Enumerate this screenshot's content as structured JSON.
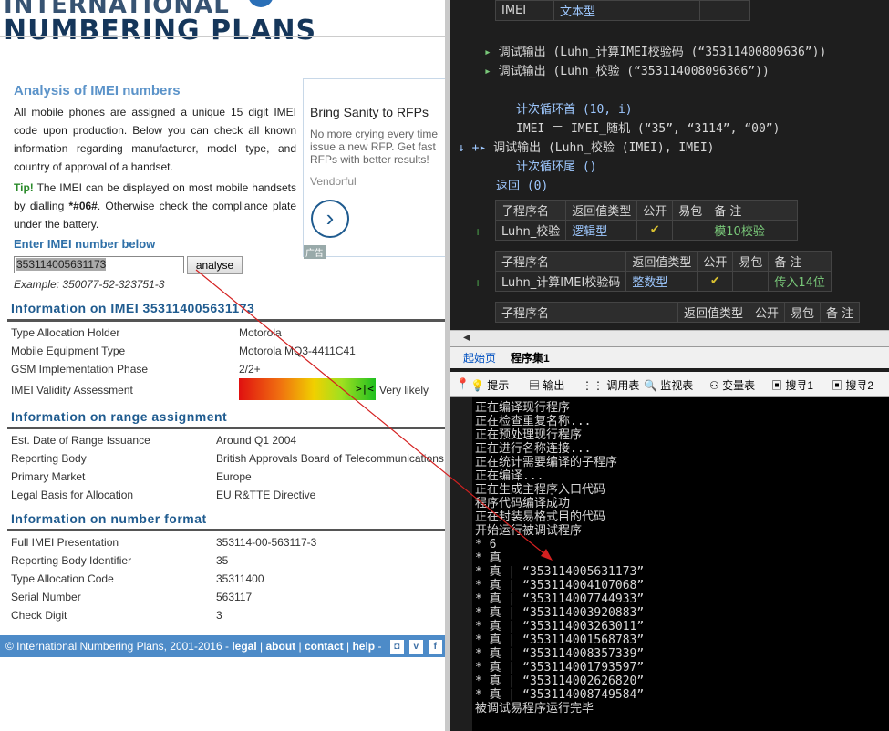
{
  "web": {
    "logo_line1": "INTERNATIONAL",
    "logo_line2": "NUMBERING PLANS",
    "heading": "Analysis of IMEI numbers",
    "intro": "All mobile phones are assigned a unique 15 digit IMEI code upon production. Below you can check all known information regarding manufacturer, model type, and country of approval of a handset.",
    "tip_label": "Tip!",
    "tip_text": " The IMEI can be displayed on most mobile handsets by dialling ",
    "tip_code": "*#06#",
    "tip_text2": ". Otherwise check the compliance plate under the battery.",
    "enter_heading": "Enter IMEI number below",
    "imei_value": "353114005631173",
    "analyse_label": "analyse",
    "example": "Example: 350077-52-323751-3",
    "sec1": "Information on IMEI 353114005631173",
    "sec1_rows": [
      {
        "k": "Type Allocation Holder",
        "v": "Motorola"
      },
      {
        "k": "Mobile Equipment Type",
        "v": "Motorola MQ3-4411C41"
      },
      {
        "k": "GSM Implementation Phase",
        "v": "2/2+"
      },
      {
        "k": "IMEI Validity Assessment",
        "v": "Very likely"
      }
    ],
    "validity_marker": ">|<",
    "validity_level": 0.92,
    "sec2": "Information on range assignment",
    "sec2_rows": [
      {
        "k": "Est. Date of Range Issuance",
        "v": "Around Q1 2004"
      },
      {
        "k": "Reporting Body",
        "v": "British Approvals Board of Telecommunications"
      },
      {
        "k": "Primary Market",
        "v": "Europe"
      },
      {
        "k": "Legal Basis for Allocation",
        "v": "EU R&TTE Directive"
      }
    ],
    "sec3": "Information on number format",
    "sec3_rows": [
      {
        "k": "Full IMEI Presentation",
        "v": "353114-00-563117-3"
      },
      {
        "k": "Reporting Body Identifier",
        "v": "35"
      },
      {
        "k": "Type Allocation Code",
        "v": "35311400"
      },
      {
        "k": "Serial Number",
        "v": "563117"
      },
      {
        "k": "Check Digit",
        "v": "3"
      }
    ],
    "ad": {
      "title": "Bring Sanity to RFPs",
      "body1": "No more crying every time",
      "body2": "issue a new RFP. Get fast",
      "body3": "RFPs with better results!",
      "vendor": "Vendorful",
      "tag": "广告",
      "arrow": "›"
    },
    "footer": {
      "copyright": "© International Numbering Plans, 2001-2016 - ",
      "legal": "legal",
      "about": "about",
      "contact": "contact",
      "help": "help",
      "sep": " | ",
      "dash": " - "
    }
  },
  "ide": {
    "top_table": {
      "name": "IMEI",
      "type": "文本型"
    },
    "line1": "调试输出 (Luhn_计算IMEI校验码 (“35311400809636”))",
    "line2": "调试输出 (Luhn_校验 (“353114008096366”))",
    "loop_start": "计次循环首 (10, i)",
    "loop_imei": "IMEI ＝ IMEI_随机 (“35”, “3114”, “00”)",
    "loop_out": "调试输出 (Luhn_校验 (IMEI), IMEI)",
    "loop_end": "计次循环尾 ()",
    "ret": "返回 (0)",
    "t1": {
      "h": [
        "子程序名",
        "返回值类型",
        "公开",
        "易包",
        "备 注"
      ],
      "r": [
        "Luhn_校验",
        "逻辑型",
        "✔",
        "",
        "模10校验"
      ]
    },
    "t2": {
      "h": [
        "子程序名",
        "返回值类型",
        "公开",
        "易包",
        "备 注"
      ],
      "r": [
        "Luhn_计算IMEI校验码",
        "整数型",
        "✔",
        "",
        "传入14位"
      ]
    },
    "t3": {
      "h": [
        "子程序名",
        "返回值类型",
        "公开",
        "易包",
        "备 注"
      ]
    },
    "tabs": [
      "起始页",
      "程序集1"
    ],
    "tools": [
      "提示",
      "输出",
      "调用表",
      "监视表",
      "变量表",
      "搜寻1",
      "搜寻2"
    ],
    "output": "正在编译现行程序\n正在检查重复名称...\n正在预处理现行程序\n正在进行名称连接...\n正在统计需要编译的子程序\n正在编译...\n正在生成主程序入口代码\n程序代码编译成功\n正在封装易格式目的代码\n开始运行被调试程序\n* 6\n* 真\n* 真 | “353114005631173”\n* 真 | “353114004107068”\n* 真 | “353114007744933”\n* 真 | “353114003920883”\n* 真 | “353114003263011”\n* 真 | “353114001568783”\n* 真 | “353114008357339”\n* 真 | “353114001793597”\n* 真 | “353114002626820”\n* 真 | “353114008749584”\n被调试易程序运行完毕"
  },
  "colors": {
    "arrow": "#d42020",
    "footer": "#4d8bc8",
    "heading": "#1f5b8f"
  }
}
